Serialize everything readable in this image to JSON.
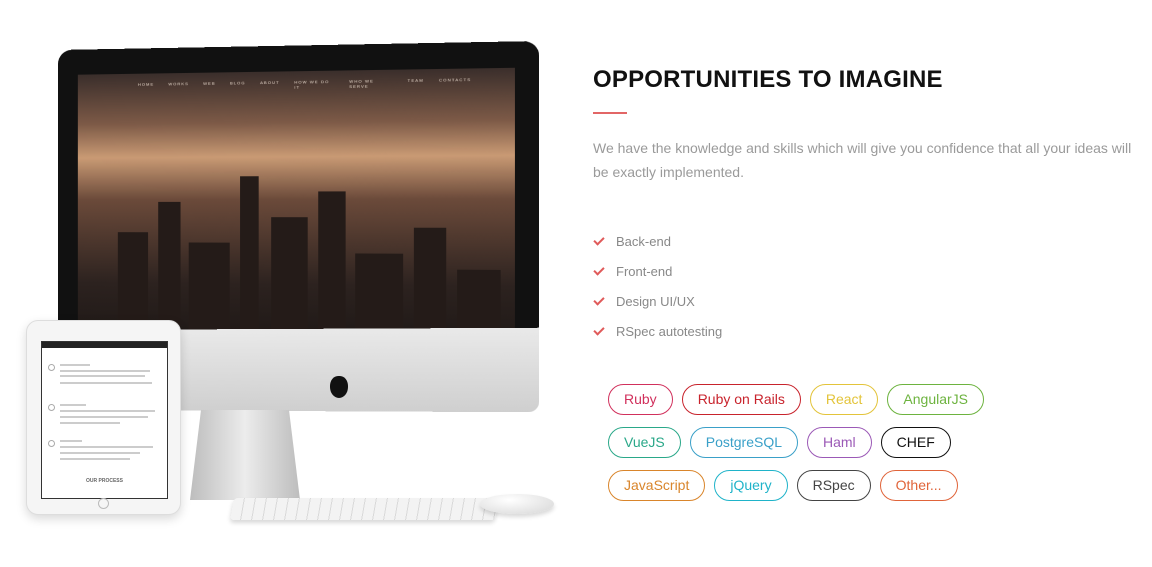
{
  "section": {
    "title": "OPPORTUNITIES TO IMAGINE",
    "description": "We have the knowledge and skills which will give you confidence that all your ideas will be exactly implemented.",
    "accent_color": "#e26666"
  },
  "features": [
    {
      "label": "Back-end",
      "icon": "check-icon"
    },
    {
      "label": "Front-end",
      "icon": "check-icon"
    },
    {
      "label": "Design UI/UX",
      "icon": "check-icon"
    },
    {
      "label": "RSpec autotesting",
      "icon": "check-icon"
    }
  ],
  "tags": [
    [
      {
        "label": "Ruby",
        "color": "#d1305c"
      },
      {
        "label": "Ruby on Rails",
        "color": "#c8232c"
      },
      {
        "label": "React",
        "color": "#e3c43a"
      },
      {
        "label": "AngularJS",
        "color": "#6db33f"
      }
    ],
    [
      {
        "label": "VueJS",
        "color": "#2aa889"
      },
      {
        "label": "PostgreSQL",
        "color": "#3aa0c8"
      },
      {
        "label": "Haml",
        "color": "#9b59b6"
      },
      {
        "label": "CHEF",
        "color": "#111111"
      }
    ],
    [
      {
        "label": "JavaScript",
        "color": "#d9852b"
      },
      {
        "label": "jQuery",
        "color": "#1fb3c9"
      },
      {
        "label": "RSpec",
        "color": "#444444"
      },
      {
        "label": "Other...",
        "color": "#e0643a"
      }
    ]
  ],
  "mockup": {
    "imac_nav": [
      "HOME",
      "WORKS",
      "WEB",
      "BLOG",
      "ABOUT",
      "HOW WE DO IT",
      "WHO WE SERVE",
      "TEAM",
      "CONTACTS"
    ],
    "ipad_caption": "OUR PROCESS"
  }
}
